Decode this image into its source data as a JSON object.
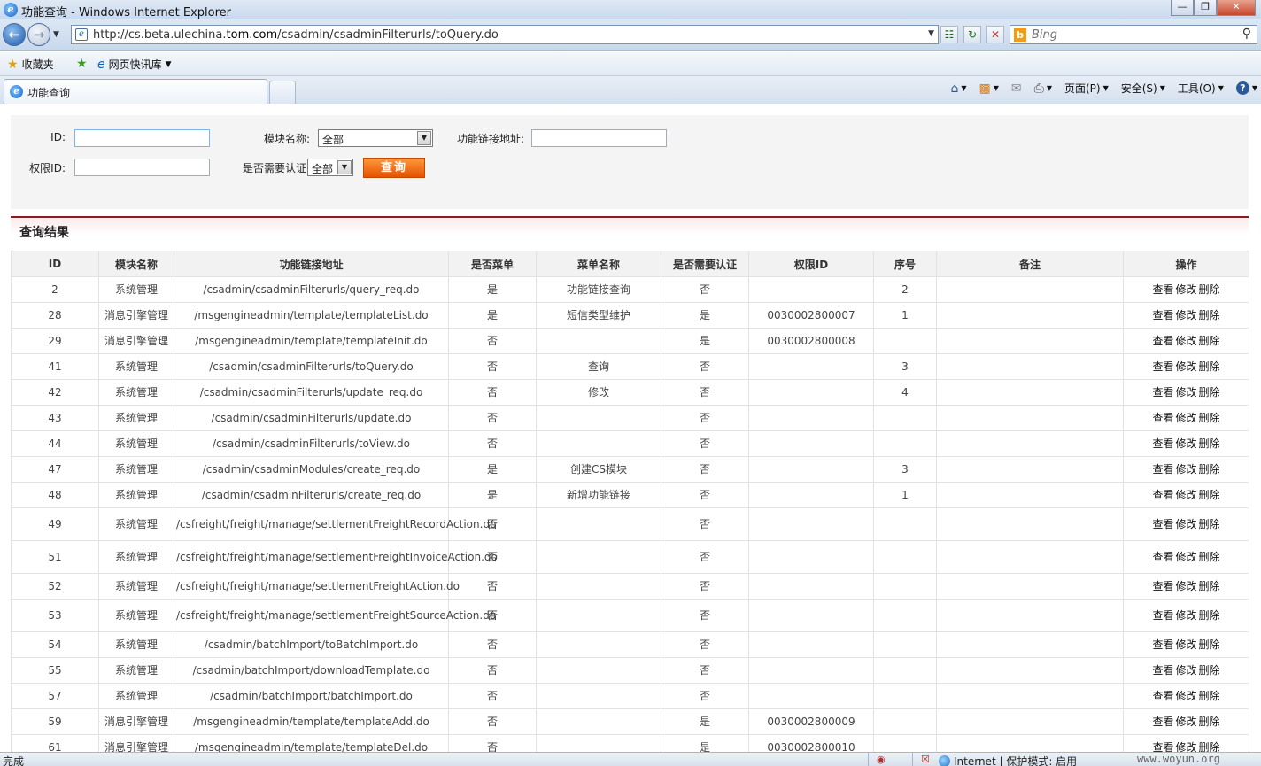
{
  "window": {
    "title": "功能查询 - Windows Internet Explorer",
    "controls": [
      "—",
      "❐",
      "✕"
    ]
  },
  "address": {
    "url_prefix": "http://cs.beta.ulechina.",
    "url_domain": "tom.com",
    "url_path": "/csadmin/csadminFilterurls/toQuery.do",
    "search_placeholder": "Bing"
  },
  "favorites": {
    "label": "收藏夹",
    "quicklink": "网页快讯库"
  },
  "tab": {
    "title": "功能查询"
  },
  "commands": {
    "page": "页面(P)",
    "safety": "安全(S)",
    "tools": "工具(O)"
  },
  "form": {
    "id_label": "ID:",
    "module_label": "模块名称:",
    "module_value": "全部",
    "link_label": "功能链接地址:",
    "perm_label": "权限ID:",
    "auth_label": "是否需要认证:",
    "auth_value": "全部",
    "query_button": "查询"
  },
  "results": {
    "title": "查询结果",
    "columns": [
      "ID",
      "模块名称",
      "功能链接地址",
      "是否菜单",
      "菜单名称",
      "是否需要认证",
      "权限ID",
      "序号",
      "备注",
      "操作"
    ],
    "actions": [
      "查看",
      "修改",
      "删除"
    ],
    "rows": [
      {
        "id": "2",
        "module": "系统管理",
        "link": "/csadmin/csadminFilterurls/query_req.do",
        "menu": "是",
        "menuname": "功能链接查询",
        "auth": "否",
        "perm": "",
        "seq": "2",
        "note": ""
      },
      {
        "id": "28",
        "module": "消息引擎管理",
        "link": "/msgengineadmin/template/templateList.do",
        "menu": "是",
        "menuname": "短信类型维护",
        "auth": "是",
        "perm": "0030002800007",
        "seq": "1",
        "note": ""
      },
      {
        "id": "29",
        "module": "消息引擎管理",
        "link": "/msgengineadmin/template/templateInit.do",
        "menu": "否",
        "menuname": "",
        "auth": "是",
        "perm": "0030002800008",
        "seq": "",
        "note": ""
      },
      {
        "id": "41",
        "module": "系统管理",
        "link": "/csadmin/csadminFilterurls/toQuery.do",
        "menu": "否",
        "menuname": "查询",
        "auth": "否",
        "perm": "",
        "seq": "3",
        "note": ""
      },
      {
        "id": "42",
        "module": "系统管理",
        "link": "/csadmin/csadminFilterurls/update_req.do",
        "menu": "否",
        "menuname": "修改",
        "auth": "否",
        "perm": "",
        "seq": "4",
        "note": ""
      },
      {
        "id": "43",
        "module": "系统管理",
        "link": "/csadmin/csadminFilterurls/update.do",
        "menu": "否",
        "menuname": "",
        "auth": "否",
        "perm": "",
        "seq": "",
        "note": ""
      },
      {
        "id": "44",
        "module": "系统管理",
        "link": "/csadmin/csadminFilterurls/toView.do",
        "menu": "否",
        "menuname": "",
        "auth": "否",
        "perm": "",
        "seq": "",
        "note": ""
      },
      {
        "id": "47",
        "module": "系统管理",
        "link": "/csadmin/csadminModules/create_req.do",
        "menu": "是",
        "menuname": "创建CS模块",
        "auth": "否",
        "perm": "",
        "seq": "3",
        "note": ""
      },
      {
        "id": "48",
        "module": "系统管理",
        "link": "/csadmin/csadminFilterurls/create_req.do",
        "menu": "是",
        "menuname": "新增功能链接",
        "auth": "否",
        "perm": "",
        "seq": "1",
        "note": ""
      },
      {
        "id": "49",
        "module": "系统管理",
        "link": "/csfreight/freight/manage/settlementFreightRecordAction.do",
        "menu": "否",
        "menuname": "",
        "auth": "否",
        "perm": "",
        "seq": "",
        "note": "",
        "tall": true
      },
      {
        "id": "51",
        "module": "系统管理",
        "link": "/csfreight/freight/manage/settlementFreightInvoiceAction.do",
        "menu": "否",
        "menuname": "",
        "auth": "否",
        "perm": "",
        "seq": "",
        "note": "",
        "tall": true
      },
      {
        "id": "52",
        "module": "系统管理",
        "link": "/csfreight/freight/manage/settlementFreightAction.do",
        "menu": "否",
        "menuname": "",
        "auth": "否",
        "perm": "",
        "seq": "",
        "note": ""
      },
      {
        "id": "53",
        "module": "系统管理",
        "link": "/csfreight/freight/manage/settlementFreightSourceAction.do",
        "menu": "否",
        "menuname": "",
        "auth": "否",
        "perm": "",
        "seq": "",
        "note": "",
        "tall": true
      },
      {
        "id": "54",
        "module": "系统管理",
        "link": "/csadmin/batchImport/toBatchImport.do",
        "menu": "否",
        "menuname": "",
        "auth": "否",
        "perm": "",
        "seq": "",
        "note": ""
      },
      {
        "id": "55",
        "module": "系统管理",
        "link": "/csadmin/batchImport/downloadTemplate.do",
        "menu": "否",
        "menuname": "",
        "auth": "否",
        "perm": "",
        "seq": "",
        "note": ""
      },
      {
        "id": "57",
        "module": "系统管理",
        "link": "/csadmin/batchImport/batchImport.do",
        "menu": "否",
        "menuname": "",
        "auth": "否",
        "perm": "",
        "seq": "",
        "note": ""
      },
      {
        "id": "59",
        "module": "消息引擎管理",
        "link": "/msgengineadmin/template/templateAdd.do",
        "menu": "否",
        "menuname": "",
        "auth": "是",
        "perm": "0030002800009",
        "seq": "",
        "note": ""
      },
      {
        "id": "61",
        "module": "消息引擎管理",
        "link": "/msgengineadmin/template/templateDel.do",
        "menu": "否",
        "menuname": "",
        "auth": "是",
        "perm": "0030002800010",
        "seq": "",
        "note": ""
      }
    ]
  },
  "status": {
    "text": "完成",
    "zone": "Internet | 保护模式: 启用",
    "watermark": "www.woyun.org"
  }
}
